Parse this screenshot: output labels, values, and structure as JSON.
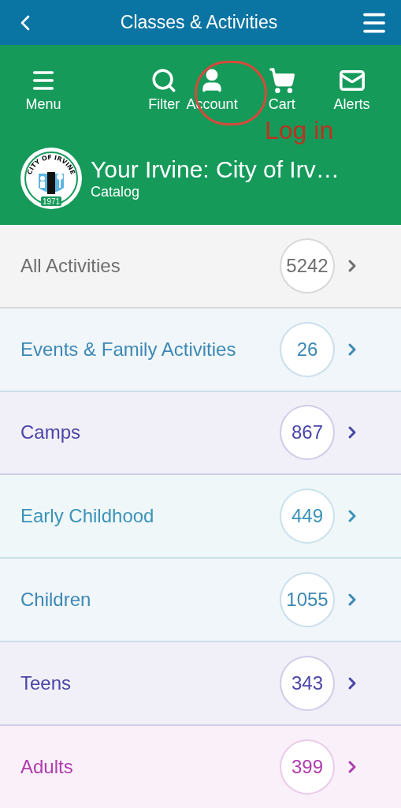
{
  "top_bar": {
    "title": "Classes & Activities"
  },
  "toolbar": {
    "items": [
      {
        "kind": "menu",
        "label": "Menu"
      },
      {
        "kind": "filter",
        "label": "Filter"
      },
      {
        "kind": "account",
        "label": "Account"
      },
      {
        "kind": "cart",
        "label": "Cart"
      },
      {
        "kind": "alerts",
        "label": "Alerts"
      }
    ]
  },
  "annotation": {
    "text": "Log in"
  },
  "organization": {
    "logo_text": "CITY OF IRVINE",
    "logo_year": "1971",
    "name": "Your Irvine: City of Irv…",
    "subtitle": "Catalog"
  },
  "categories": [
    {
      "label": "All Activities",
      "count": "5242",
      "color": "#6e6e6e"
    },
    {
      "label": "Events & Family Activities",
      "count": "26",
      "color": "#3d88b5"
    },
    {
      "label": "Camps",
      "count": "867",
      "color": "#4a44a8"
    },
    {
      "label": "Early Childhood",
      "count": "449",
      "color": "#3b93b8"
    },
    {
      "label": "Children",
      "count": "1055",
      "color": "#3d88b5"
    },
    {
      "label": "Teens",
      "count": "343",
      "color": "#4a44a8"
    },
    {
      "label": "Adults",
      "count": "399",
      "color": "#b03cae"
    }
  ]
}
